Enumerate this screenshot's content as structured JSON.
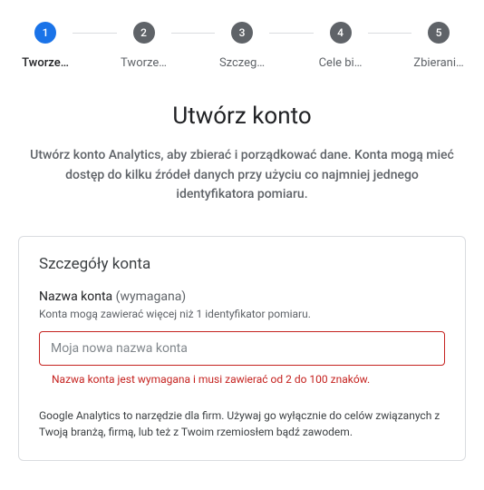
{
  "stepper": {
    "steps": [
      {
        "num": "1",
        "label": "Tworze…",
        "active": true
      },
      {
        "num": "2",
        "label": "Tworze…",
        "active": false
      },
      {
        "num": "3",
        "label": "Szczeg…",
        "active": false
      },
      {
        "num": "4",
        "label": "Cele bi…",
        "active": false
      },
      {
        "num": "5",
        "label": "Zbierani…",
        "active": false
      }
    ]
  },
  "main": {
    "title": "Utwórz konto",
    "subtitle": "Utwórz konto Analytics, aby zbierać i porządkować dane. Konta mogą mieć dostęp do kilku źródeł danych przy użyciu co najmniej jednego identyfikatora pomiaru."
  },
  "card": {
    "title": "Szczegóły konta",
    "field_label": "Nazwa konta",
    "field_required": "(wymagana)",
    "field_hint": "Konta mogą zawierać więcej niż 1 identyfikator pomiaru.",
    "placeholder": "Moja nowa nazwa konta",
    "value": "",
    "error": "Nazwa konta jest wymagana i musi zawierać od 2 do 100 znaków.",
    "disclaimer": "Google Analytics to narzędzie dla firm. Używaj go wyłącznie do celów związanych z Twoją branżą, firmą, lub też z Twoim rzemiosłem bądź zawodem."
  },
  "colors": {
    "primary": "#1a73e8",
    "error": "#c5221f",
    "grey_circle": "#5f6368"
  }
}
